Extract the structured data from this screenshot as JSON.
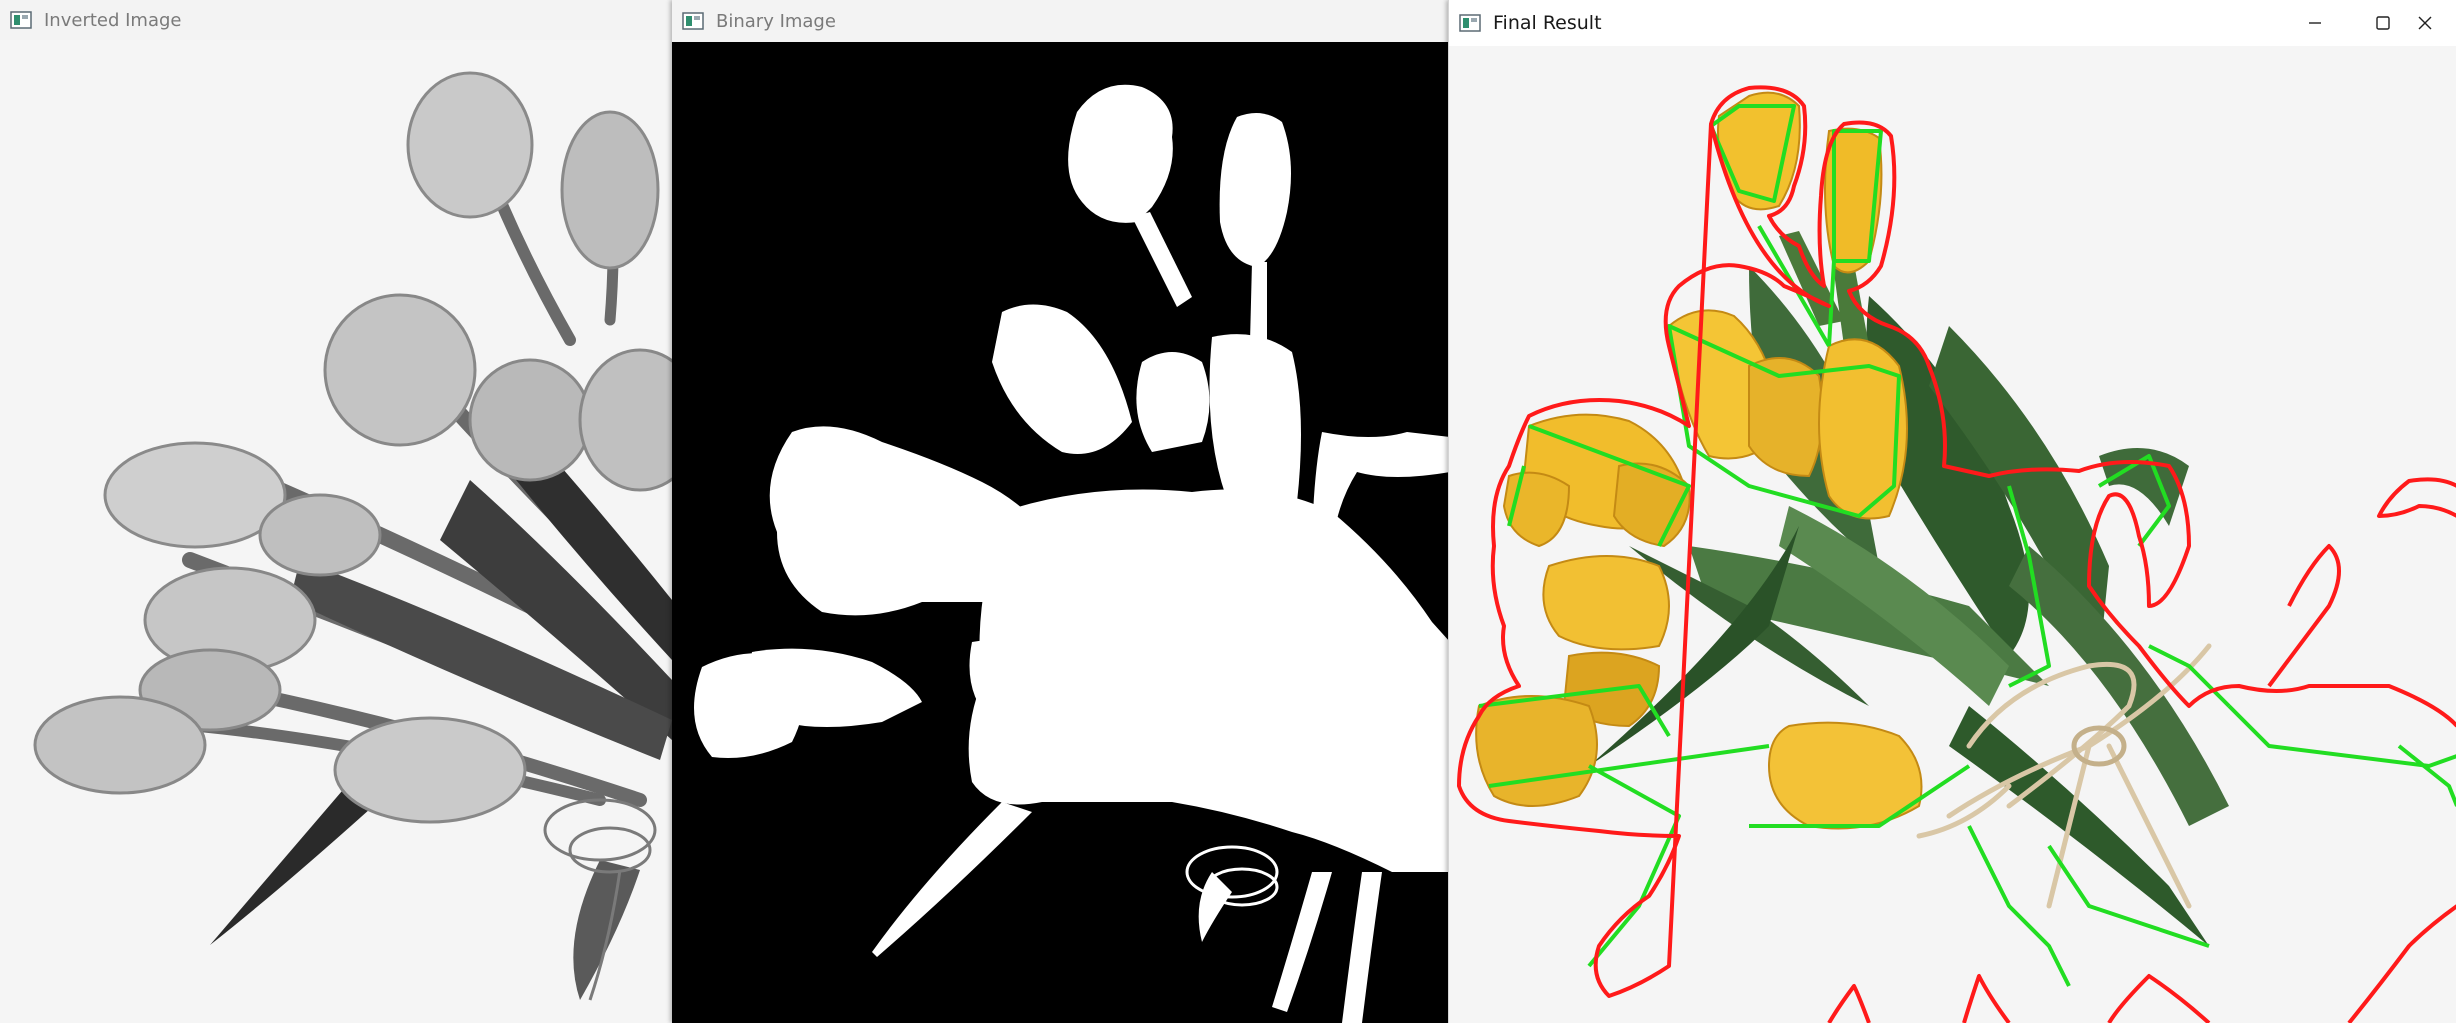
{
  "windows": {
    "inverted": {
      "title": "Inverted Image",
      "icon": "opencv-window-icon"
    },
    "binary": {
      "title": "Binary Image",
      "icon": "opencv-window-icon"
    },
    "final": {
      "title": "Final Result",
      "icon": "opencv-window-icon",
      "controls": [
        "minimize-icon",
        "maximize-icon",
        "close-icon"
      ]
    }
  },
  "colors": {
    "contour": "#ff1a1a",
    "hull": "#22dd22",
    "petal_yellow": "#f2c12e",
    "leaf_green": "#3f6b3a",
    "bow_twine": "#d9c7a6",
    "binary_fg": "#ffffff",
    "binary_bg": "#000000"
  }
}
